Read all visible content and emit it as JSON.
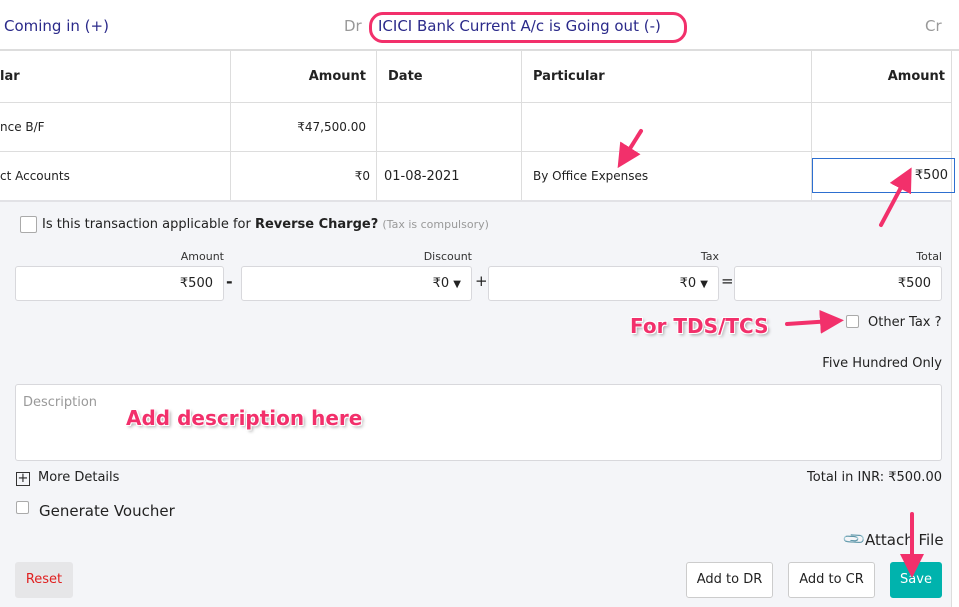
{
  "header": {
    "left_title": "Coming in (+)",
    "dr_label": "Dr",
    "right_title": "ICICI Bank Current A/c is Going out (-)",
    "cr_label": "Cr"
  },
  "table": {
    "columns": [
      "lar",
      "Amount",
      "Date",
      "Particular",
      "Amount"
    ],
    "rows": [
      {
        "particular": "nce B/F",
        "amount": "₹47,500.00",
        "date": "",
        "particular2": "",
        "amount2": ""
      },
      {
        "particular": "ct Accounts",
        "amount": "₹0",
        "date": "01-08-2021",
        "particular2": "By Office Expenses",
        "amount2": "₹500"
      }
    ]
  },
  "form": {
    "reverse_charge_prefix": "Is this transaction applicable for ",
    "reverse_charge_bold": "Reverse Charge?",
    "reverse_charge_note": "(Tax is compulsory)",
    "amount_label": "Amount",
    "amount_value": "₹500",
    "discount_label": "Discount",
    "discount_value": "₹0",
    "tax_label": "Tax",
    "tax_value": "₹0",
    "total_label": "Total",
    "total_value": "₹500",
    "op_minus": "-",
    "op_plus": "+",
    "op_equals": "=",
    "other_tax_label": "Other Tax ?",
    "amount_in_words": "Five Hundred Only",
    "description_placeholder": "Description",
    "more_details": "More Details",
    "total_inr": "Total in INR: ₹500.00",
    "generate_voucher": "Generate Voucher",
    "attach_file": "Attach File",
    "reset": "Reset",
    "add_to_dr": "Add to DR",
    "add_to_cr": "Add to CR",
    "save": "Save"
  },
  "annotations": {
    "tds": "For TDS/TCS",
    "description": "Add description here"
  },
  "colors": {
    "accent": "#2b2a8a",
    "save": "#00b3ad",
    "reset": "#e02020",
    "annotation": "#f2306b"
  }
}
